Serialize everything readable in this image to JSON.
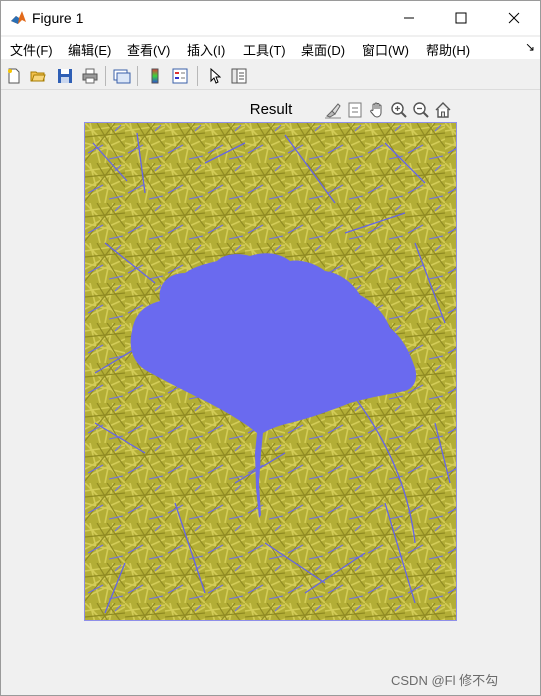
{
  "window": {
    "title": "Figure 1"
  },
  "menu": [
    {
      "label": "文件(F)"
    },
    {
      "label": "编辑(E)"
    },
    {
      "label": "查看(V)"
    },
    {
      "label": "插入(I)"
    },
    {
      "label": "工具(T)"
    },
    {
      "label": "桌面(D)"
    },
    {
      "label": "窗口(W)"
    },
    {
      "label": "帮助(H)"
    }
  ],
  "menu_overflow_arrow": "↘",
  "toolbar": {
    "icons": [
      "new-figure-icon",
      "open-file-icon",
      "save-icon",
      "print-icon",
      "link-plot-icon",
      "insert-colorbar-icon",
      "insert-legend-icon",
      "edit-plot-pointer-icon",
      "property-inspector-icon"
    ]
  },
  "axes": {
    "title": "Result",
    "toolbar_icons": [
      "brush-icon",
      "data-tips-icon",
      "pan-hand-icon",
      "zoom-in-icon",
      "zoom-out-icon",
      "home-restore-icon"
    ]
  },
  "image": {
    "description_colors": {
      "background_grass": "#b8b43a",
      "mask_region": "#6b6bef"
    }
  },
  "watermark": {
    "text": "CSDN @Fl 修不勾"
  },
  "colors": {
    "window_bg": "#f0f0f0",
    "titlebar_bg": "#ffffff",
    "mask_blue": "#6b6bef",
    "grass_yellow": "#b8b43a"
  }
}
